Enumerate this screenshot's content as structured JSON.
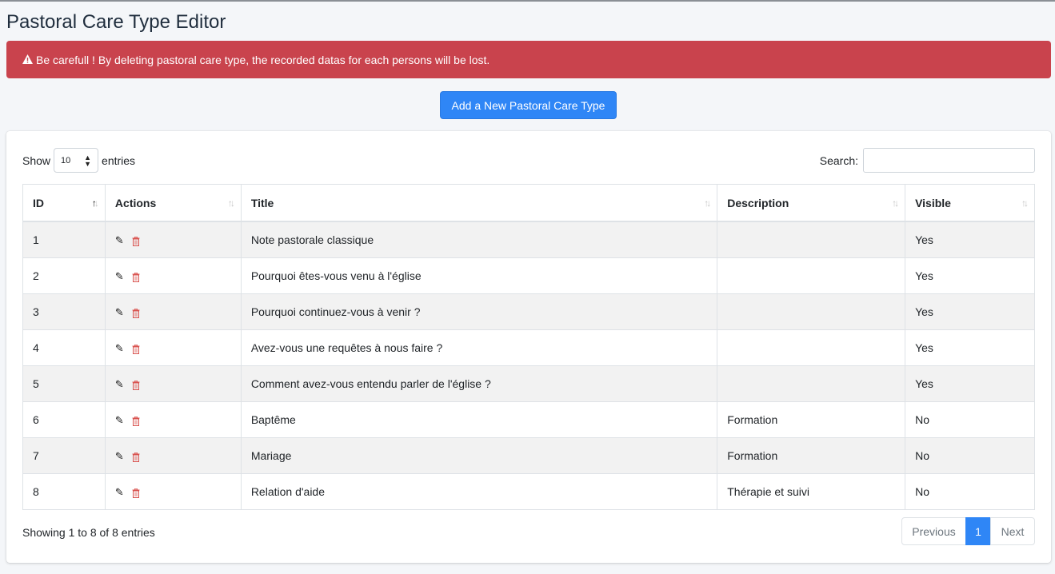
{
  "page": {
    "title": "Pastoral Care Type Editor"
  },
  "alert": {
    "icon": "warning-icon",
    "text": "Be carefull ! By deleting pastoral care type, the recorded datas for each persons will be lost."
  },
  "add_button": {
    "label": "Add a New Pastoral Care Type"
  },
  "length": {
    "show_label": "Show",
    "value": "10",
    "entries_label": "entries"
  },
  "search": {
    "label": "Search:",
    "value": ""
  },
  "table": {
    "headers": [
      "ID",
      "Actions",
      "Title",
      "Description",
      "Visible"
    ],
    "sorted_column": "ID",
    "rows": [
      {
        "id": "1",
        "title": "Note pastorale classique",
        "description": "",
        "visible": "Yes"
      },
      {
        "id": "2",
        "title": "Pourquoi êtes-vous venu à l'église",
        "description": "",
        "visible": "Yes"
      },
      {
        "id": "3",
        "title": "Pourquoi continuez-vous à venir ?",
        "description": "",
        "visible": "Yes"
      },
      {
        "id": "4",
        "title": "Avez-vous une requêtes à nous faire ?",
        "description": "",
        "visible": "Yes"
      },
      {
        "id": "5",
        "title": "Comment avez-vous entendu parler de l'église ?",
        "description": "",
        "visible": "Yes"
      },
      {
        "id": "6",
        "title": "Baptême",
        "description": "Formation",
        "visible": "No"
      },
      {
        "id": "7",
        "title": "Mariage",
        "description": "Formation",
        "visible": "No"
      },
      {
        "id": "8",
        "title": "Relation d'aide",
        "description": "Thérapie et suivi",
        "visible": "No"
      }
    ]
  },
  "footer": {
    "info": "Showing 1 to 8 of 8 entries"
  },
  "pagination": {
    "previous": "Previous",
    "current": "1",
    "next": "Next"
  },
  "colors": {
    "alert": "#c9434d",
    "primary": "#2f86f6",
    "trash": "#d9534f"
  }
}
